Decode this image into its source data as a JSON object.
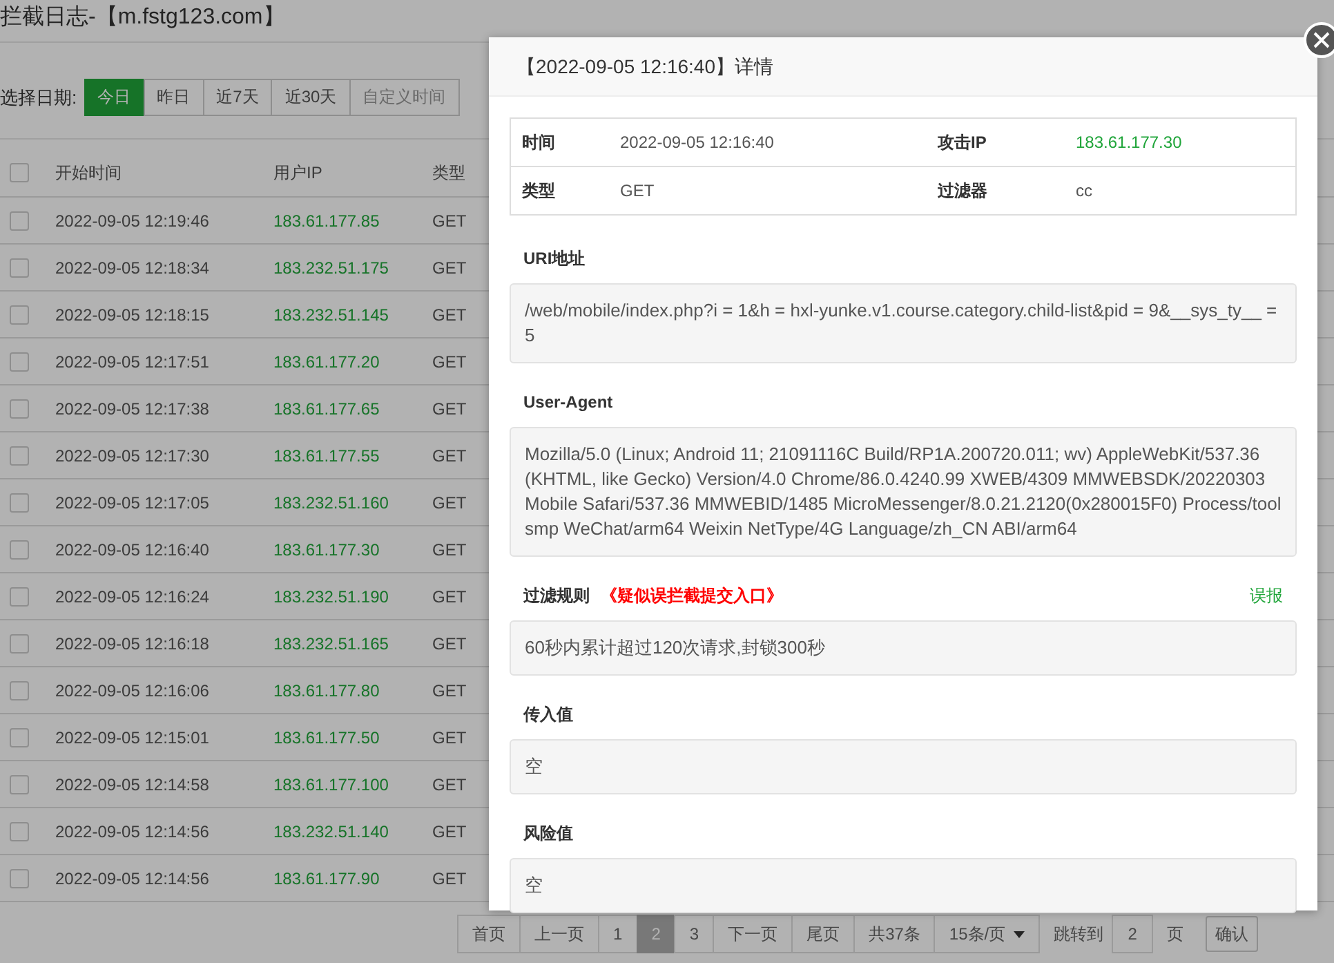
{
  "page": {
    "title": "拦截日志-【m.fstg123.com】",
    "date_filter": {
      "label": "选择日期:",
      "options": [
        {
          "label": "今日",
          "selected": true
        },
        {
          "label": "昨日",
          "selected": false
        },
        {
          "label": "近7天",
          "selected": false
        },
        {
          "label": "近30天",
          "selected": false
        },
        {
          "label": "自定义时间",
          "selected": false
        }
      ]
    },
    "table": {
      "columns": [
        "开始时间",
        "用户IP",
        "类型"
      ],
      "header_checked": false,
      "rows": [
        {
          "checked": false,
          "time": "2022-09-05 12:19:46",
          "ip": "183.61.177.85",
          "type": "GET"
        },
        {
          "checked": false,
          "time": "2022-09-05 12:18:34",
          "ip": "183.232.51.175",
          "type": "GET"
        },
        {
          "checked": false,
          "time": "2022-09-05 12:18:15",
          "ip": "183.232.51.145",
          "type": "GET"
        },
        {
          "checked": false,
          "time": "2022-09-05 12:17:51",
          "ip": "183.61.177.20",
          "type": "GET"
        },
        {
          "checked": false,
          "time": "2022-09-05 12:17:38",
          "ip": "183.61.177.65",
          "type": "GET"
        },
        {
          "checked": false,
          "time": "2022-09-05 12:17:30",
          "ip": "183.61.177.55",
          "type": "GET"
        },
        {
          "checked": false,
          "time": "2022-09-05 12:17:05",
          "ip": "183.232.51.160",
          "type": "GET"
        },
        {
          "checked": false,
          "time": "2022-09-05 12:16:40",
          "ip": "183.61.177.30",
          "type": "GET"
        },
        {
          "checked": false,
          "time": "2022-09-05 12:16:24",
          "ip": "183.232.51.190",
          "type": "GET"
        },
        {
          "checked": false,
          "time": "2022-09-05 12:16:18",
          "ip": "183.232.51.165",
          "type": "GET"
        },
        {
          "checked": false,
          "time": "2022-09-05 12:16:06",
          "ip": "183.61.177.80",
          "type": "GET"
        },
        {
          "checked": false,
          "time": "2022-09-05 12:15:01",
          "ip": "183.61.177.50",
          "type": "GET"
        },
        {
          "checked": false,
          "time": "2022-09-05 12:14:58",
          "ip": "183.61.177.100",
          "type": "GET"
        },
        {
          "checked": false,
          "time": "2022-09-05 12:14:56",
          "ip": "183.232.51.140",
          "type": "GET"
        },
        {
          "checked": false,
          "time": "2022-09-05 12:14:56",
          "ip": "183.61.177.90",
          "type": "GET"
        }
      ]
    },
    "pagination": {
      "first": "首页",
      "prev": "上一页",
      "pages": [
        {
          "label": "1",
          "selected": false
        },
        {
          "label": "2",
          "selected": true
        },
        {
          "label": "3",
          "selected": false
        }
      ],
      "next": "下一页",
      "last": "尾页",
      "total": "共37条",
      "page_size": "15条/页",
      "jump_label": "跳转到",
      "jump_value": "2",
      "page_unit": "页",
      "confirm": "确认"
    }
  },
  "dialog": {
    "title": "【2022-09-05 12:16:40】详情",
    "info": [
      {
        "label": "时间",
        "value": "2022-09-05 12:16:40",
        "kind": "text"
      },
      {
        "label": "攻击IP",
        "value": "183.61.177.30",
        "kind": "ip"
      },
      {
        "label": "类型",
        "value": "GET",
        "kind": "text"
      },
      {
        "label": "过滤器",
        "value": "cc",
        "kind": "text"
      }
    ],
    "sections": [
      {
        "label": "URI地址",
        "value": "/web/mobile/index.php?i = 1&h = hxl-yunke.v1.course.category.child-list&pid = 9&__sys_ty__ = 5"
      },
      {
        "label": "User-Agent",
        "value": "Mozilla/5.0 (Linux; Android 11; 21091116C Build/RP1A.200720.011; wv) AppleWebKit/537.36 (KHTML, like Gecko) Version/4.0 Chrome/86.0.4240.99 XWEB/4309 MMWEBSDK/20220303 Mobile Safari/537.36 MMWEBID/1485 MicroMessenger/8.0.21.2120(0x280015F0) Process/toolsmp WeChat/arm64 Weixin NetType/4G Language/zh_CN ABI/arm64"
      },
      {
        "label": "过滤规则",
        "note": "《疑似误拦截提交入口》",
        "action": "误报",
        "value": "60秒内累计超过120次请求,封锁300秒"
      },
      {
        "label": "传入值",
        "value": "空"
      },
      {
        "label": "风险值",
        "value": "空"
      }
    ]
  }
}
